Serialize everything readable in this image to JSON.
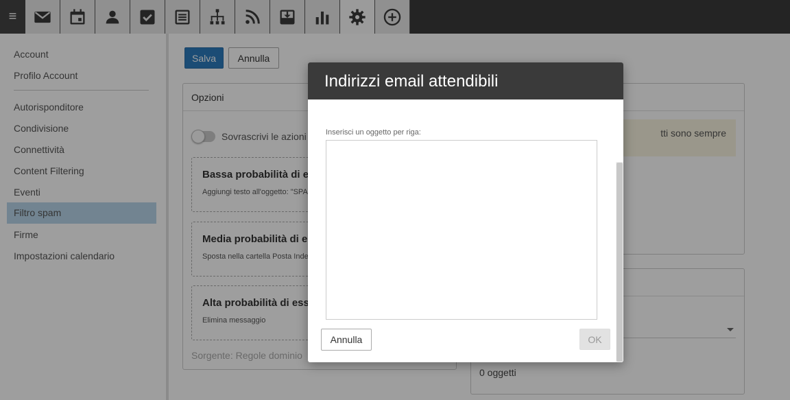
{
  "toolbar": {
    "menu_glyph": "≡",
    "icons": [
      "mail-icon",
      "calendar-icon",
      "contacts-icon",
      "tasks-icon",
      "notes-icon",
      "sitemap-icon",
      "rss-icon",
      "download-icon",
      "chart-icon",
      "gear-icon",
      "add-icon"
    ],
    "active_icon": "gear-icon"
  },
  "sidebar": {
    "items": [
      {
        "label": "Account"
      },
      {
        "label": "Profilo Account"
      },
      {
        "label": "Autorisponditore"
      },
      {
        "label": "Condivisione"
      },
      {
        "label": "Connettività"
      },
      {
        "label": "Content Filtering"
      },
      {
        "label": "Eventi"
      },
      {
        "label": "Filtro spam"
      },
      {
        "label": "Firme"
      },
      {
        "label": "Impostazioni calendario"
      }
    ],
    "selected": "Filtro spam"
  },
  "actions": {
    "save_label": "Salva",
    "cancel_label": "Annulla"
  },
  "options_panel": {
    "title": "Opzioni",
    "toggle_label": "Sovrascrivi le azioni d",
    "rules": [
      {
        "title": "Bassa probabilità di es",
        "action": "Aggiungi testo all'oggetto: \"SPA"
      },
      {
        "title": "Media probabilità di e",
        "action": "Sposta nella cartella Posta Indes"
      },
      {
        "title": "Alta probabilità di ess",
        "action": "Elimina messaggio"
      }
    ],
    "source": "Sorgente: Regole dominio"
  },
  "right_panel": {
    "info_text": "tti sono sempre",
    "count_text": "0 oggetti"
  },
  "modal": {
    "title": "Indirizzi email attendibili",
    "field_label": "Inserisci un oggetto per riga:",
    "textarea_value": "",
    "cancel_label": "Annulla",
    "ok_label": "OK"
  },
  "colors": {
    "topbar": "#3a3a3a",
    "primary": "#2d7bbd",
    "selected_nav": "#b9d6ea",
    "info_bg": "#f8f4e0"
  }
}
